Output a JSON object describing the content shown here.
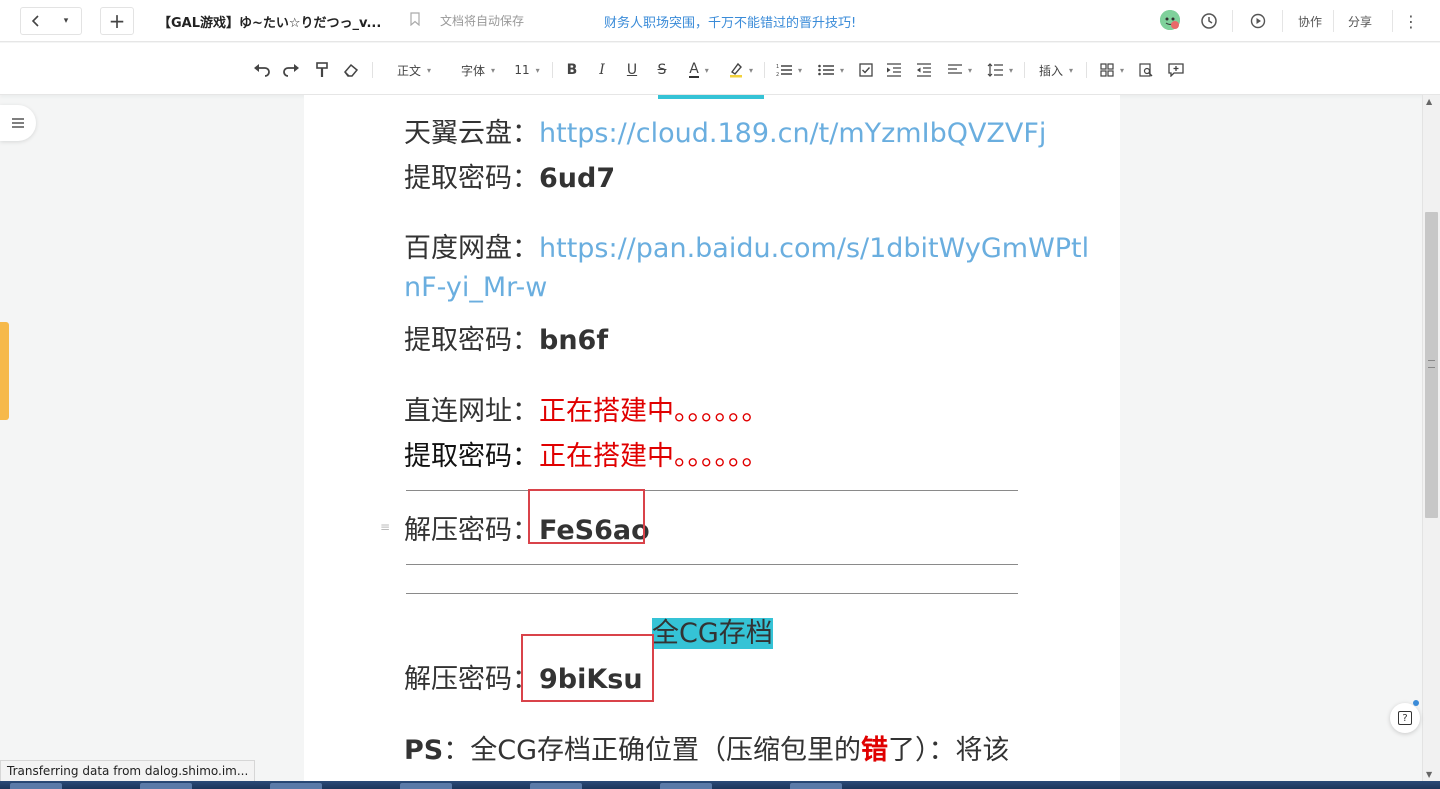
{
  "topbar": {
    "back_label": "<",
    "dropdown_label": "▾",
    "new_label": "+",
    "doc_title": "【GAL游戏】ゆ~たい☆りだつっ_v...",
    "save_status": "文档将自动保存",
    "promo_text": "财务人职场突围，千万不能错过的晋升技巧!",
    "collab_label": "协作",
    "share_label": "分享",
    "more_label": "⋮"
  },
  "toolbar": {
    "style_label": "正文",
    "font_label": "字体",
    "size_label": "11",
    "insert_label": "插入"
  },
  "document": {
    "tianyi_label": "天翼云盘：",
    "tianyi_link": "https://cloud.189.cn/t/mYzmIbQVZVFj",
    "code_label_1": "提取密码：",
    "code_1": "6ud7",
    "baidu_label": "百度网盘：",
    "baidu_link_line1": "https://pan.baidu.com/s/1dbitWyGmWPtl",
    "baidu_link_line2": "nF-yi_Mr-w",
    "code_label_2": "提取密码：",
    "code_2": "bn6f",
    "direct_label": "直连网址：",
    "direct_value": "正在搭建中。。。。。。",
    "code_label_3": "提取密码：",
    "code_3": "正在搭建中。。。。。。",
    "unzip_label_1": "解压密码：",
    "unzip_1": "FeS6ao",
    "cg_heading": "全CG存档",
    "unzip_label_2": "解压密码：",
    "unzip_2": "9biKsu",
    "ps_label": "PS",
    "ps_text_a": "：全CG存档正确位置（压缩包里的",
    "ps_text_err": "错",
    "ps_text_b": "了）：将该"
  },
  "statusbar": {
    "text": "Transferring data from dalog.shimo.im..."
  },
  "help": {
    "label": "?"
  },
  "colors": {
    "link": "#6aaedf",
    "highlight": "#35c3d6",
    "red_text": "#e00000",
    "box_border": "#d9434a",
    "accent_marker": "#f6b94a",
    "promo": "#3a8bd8"
  }
}
